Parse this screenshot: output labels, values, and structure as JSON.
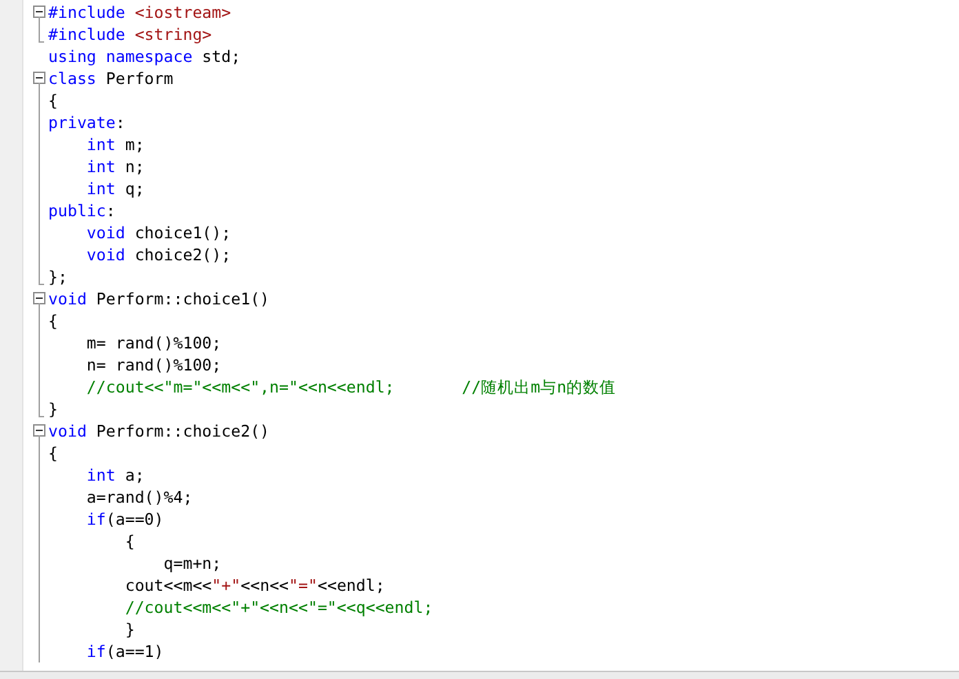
{
  "editor": {
    "lines": [
      {
        "kind": "opener",
        "segments": [
          {
            "kind": "keyword",
            "text": "#include"
          },
          {
            "kind": "string",
            "text": " <iostream>"
          }
        ]
      },
      {
        "kind": "closer",
        "segments": [
          {
            "kind": "keyword",
            "text": "#include"
          },
          {
            "kind": "string",
            "text": " <string>"
          }
        ]
      },
      {
        "kind": "plain",
        "segments": [
          {
            "kind": "keyword",
            "text": "using namespace"
          },
          {
            "kind": "plain",
            "text": " std;"
          }
        ]
      },
      {
        "kind": "opener",
        "segments": [
          {
            "kind": "keyword",
            "text": "class"
          },
          {
            "kind": "plain",
            "text": " Perform"
          }
        ]
      },
      {
        "kind": "body",
        "segments": [
          {
            "kind": "plain",
            "text": "{"
          }
        ]
      },
      {
        "kind": "body",
        "segments": [
          {
            "kind": "keyword",
            "text": "private"
          },
          {
            "kind": "plain",
            "text": ":"
          }
        ]
      },
      {
        "kind": "body",
        "segments": [
          {
            "kind": "keyword",
            "text": "    int"
          },
          {
            "kind": "plain",
            "text": " m;"
          }
        ]
      },
      {
        "kind": "body",
        "segments": [
          {
            "kind": "keyword",
            "text": "    int"
          },
          {
            "kind": "plain",
            "text": " n;"
          }
        ]
      },
      {
        "kind": "body",
        "segments": [
          {
            "kind": "keyword",
            "text": "    int"
          },
          {
            "kind": "plain",
            "text": " q;"
          }
        ]
      },
      {
        "kind": "body",
        "segments": [
          {
            "kind": "keyword",
            "text": "public"
          },
          {
            "kind": "plain",
            "text": ":"
          }
        ]
      },
      {
        "kind": "body",
        "segments": [
          {
            "kind": "keyword",
            "text": "    void"
          },
          {
            "kind": "plain",
            "text": " choice1();"
          }
        ]
      },
      {
        "kind": "body",
        "segments": [
          {
            "kind": "keyword",
            "text": "    void"
          },
          {
            "kind": "plain",
            "text": " choice2();"
          }
        ]
      },
      {
        "kind": "closer",
        "segments": [
          {
            "kind": "plain",
            "text": "};"
          }
        ]
      },
      {
        "kind": "opener",
        "segments": [
          {
            "kind": "keyword",
            "text": "void"
          },
          {
            "kind": "plain",
            "text": " Perform::choice1()"
          }
        ]
      },
      {
        "kind": "body",
        "segments": [
          {
            "kind": "plain",
            "text": "{"
          }
        ]
      },
      {
        "kind": "body",
        "segments": [
          {
            "kind": "plain",
            "text": "    m= rand()%100;"
          }
        ]
      },
      {
        "kind": "body",
        "segments": [
          {
            "kind": "plain",
            "text": "    n= rand()%100;"
          }
        ]
      },
      {
        "kind": "body",
        "segments": [
          {
            "kind": "comment",
            "text": "    //cout<<\"m=\"<<m<<\",n=\"<<n<<endl;       //随机出m与n的数值"
          }
        ]
      },
      {
        "kind": "closer",
        "segments": [
          {
            "kind": "plain",
            "text": "}"
          }
        ]
      },
      {
        "kind": "opener",
        "segments": [
          {
            "kind": "keyword",
            "text": "void"
          },
          {
            "kind": "plain",
            "text": " Perform::choice2()"
          }
        ]
      },
      {
        "kind": "body",
        "segments": [
          {
            "kind": "plain",
            "text": "{"
          }
        ]
      },
      {
        "kind": "body",
        "segments": [
          {
            "kind": "keyword",
            "text": "    int"
          },
          {
            "kind": "plain",
            "text": " a;"
          }
        ]
      },
      {
        "kind": "body",
        "segments": [
          {
            "kind": "plain",
            "text": "    a=rand()%4;"
          }
        ]
      },
      {
        "kind": "body",
        "segments": [
          {
            "kind": "keyword",
            "text": "    if"
          },
          {
            "kind": "plain",
            "text": "(a==0)"
          }
        ]
      },
      {
        "kind": "body",
        "segments": [
          {
            "kind": "plain",
            "text": "        {"
          }
        ]
      },
      {
        "kind": "body",
        "segments": [
          {
            "kind": "plain",
            "text": "            q=m+n;"
          }
        ]
      },
      {
        "kind": "body",
        "segments": [
          {
            "kind": "plain",
            "text": "        cout<<m<<"
          },
          {
            "kind": "string",
            "text": "\"+\""
          },
          {
            "kind": "plain",
            "text": "<<n<<"
          },
          {
            "kind": "string",
            "text": "\"=\""
          },
          {
            "kind": "plain",
            "text": "<<endl;"
          }
        ]
      },
      {
        "kind": "body",
        "segments": [
          {
            "kind": "comment",
            "text": "        //cout<<m<<\"+\"<<n<<\"=\"<<q<<endl;"
          }
        ]
      },
      {
        "kind": "body",
        "segments": [
          {
            "kind": "plain",
            "text": "        }"
          }
        ]
      },
      {
        "kind": "body",
        "segments": [
          {
            "kind": "keyword",
            "text": "    if"
          },
          {
            "kind": "plain",
            "text": "(a==1)"
          }
        ]
      }
    ]
  }
}
